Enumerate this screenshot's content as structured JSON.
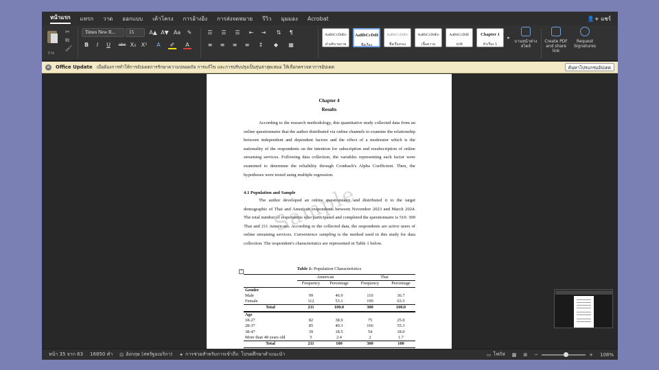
{
  "tabs": [
    "หน้าแรก",
    "แทรก",
    "วาด",
    "ออกแบบ",
    "เค้าโครง",
    "การอ้างอิง",
    "การส่งจดหมาย",
    "รีวิว",
    "มุมมอง",
    "Acrobat"
  ],
  "share_label": "แชร์",
  "ribbon": {
    "paste_label": "วาง",
    "font_name": "Times New R...",
    "font_size": "15",
    "styles": [
      {
        "sample": "AaBbCcDdEe",
        "name": "คำอธิบายภาพ"
      },
      {
        "sample": "AaBbCcDdI",
        "name": "ชื่อเรื่อง"
      },
      {
        "sample": "AaBbCcDdEe",
        "name": "ชื่อเรื่องรอง"
      },
      {
        "sample": "AaBbCcDdEe",
        "name": "เนื้อความ"
      },
      {
        "sample": "AaBbCcDdE",
        "name": "ปกติ"
      },
      {
        "sample": "Chapter 1",
        "name": "หัวเรื่อง 1"
      }
    ],
    "styles_pane_label": "บานหน้าต่างสไตล์",
    "create_pdf_label": "Create PDF and share link",
    "request_signatures_label": "Request Signatures"
  },
  "update_bar": {
    "title": "Office Update",
    "message": "เมื่อต้องการทำให้การอัปเดตการรักษาความปลอดภัย การแก้ไข และการปรับปรุงเป็นรุ่นล่าสุดเสมอ ให้เลือกตรวจหาการอัปเดต",
    "button": "ค้นหาโปรแกรมอัปเดต"
  },
  "document": {
    "chapter": "Chapter 4",
    "chapter_title": "Results",
    "para1": "According to the research methodology, this quantitative study collected data from an online questionnaire that the author distributed via online channels to examine the relationship between independent and dependent factors and the effect of a moderator which is the nationality of the respondents on the intention for subscription and resubscription of online streaming services. Following data collection, the variables representing each factor were examined to determine the reliability through Cronbach's Alpha Coefficient. Then, the hypotheses were tested using multiple regression.",
    "section_heading": "4.1 Population and Sample",
    "para2_a": "The author developed an online questionnaire and distributed it to the target demographic of Thai and American respondents between November 2023 and March 2024. The total number of respondents who participated and completed the questionnaire is 510: 300 Thai and 211 Americans. According to the collected data, the respondents are active users of online streaming services.",
    "para2_italic": "Convenience sampling",
    "para2_b": "is the method used in this study for data collection. The respondent's characteristics are represented in Table 1 below.",
    "watermark": "Sample",
    "table_caption_bold": "Table 1:",
    "table_caption": "Population Characteristics",
    "table": {
      "group_american": "American",
      "group_thai": "Thai",
      "col_frequency": "Frequency",
      "col_percentage": "Percentage",
      "gender": {
        "label": "Gender",
        "rows": [
          [
            "Male",
            "99",
            "46.9",
            "110",
            "36.7"
          ],
          [
            "Female",
            "112",
            "53.1",
            "190",
            "63.3"
          ]
        ],
        "total": [
          "Total",
          "211",
          "100.0",
          "300",
          "100.0"
        ]
      },
      "age": {
        "label": "Age",
        "rows": [
          [
            "18-27",
            "82",
            "38.9",
            "75",
            "25.0"
          ],
          [
            "28-37",
            "85",
            "40.3",
            "166",
            "55.3"
          ],
          [
            "38-47",
            "39",
            "18.5",
            "54",
            "18.0"
          ],
          [
            "More than 48 years old",
            "5",
            "2.4",
            "2",
            "1.7"
          ]
        ],
        "total": [
          "Total",
          "211",
          "100",
          "300",
          "100"
        ]
      }
    }
  },
  "status_bar": {
    "page": "หน้า 35 จาก 63",
    "words": "16850 คำ",
    "language": "อังกฤษ (สหรัฐอเมริกา)",
    "accessibility": "การช่วยสำหรับการเข้าถึง: โปรดศึกษาคำแนะนำ",
    "focus": "โฟกัส",
    "zoom": "108%"
  }
}
